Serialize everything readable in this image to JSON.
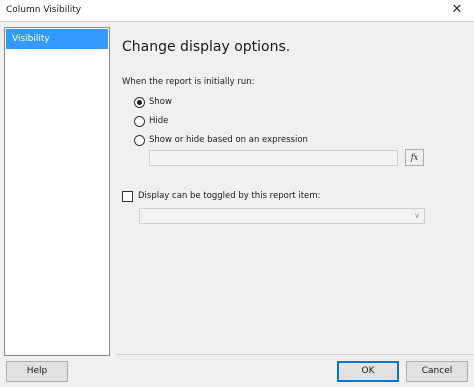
{
  "window": {
    "title": "Column Visibility",
    "close_glyph": "✕"
  },
  "sidebar": {
    "items": [
      {
        "label": "Visibility",
        "selected": true
      }
    ]
  },
  "main": {
    "heading": "Change display options.",
    "intro_label": "When the report is initially run:",
    "radio_options": [
      {
        "label": "Show",
        "checked": true
      },
      {
        "label": "Hide",
        "checked": false
      },
      {
        "label": "Show or hide based on an expression",
        "checked": false
      }
    ],
    "expression_field": {
      "value": "",
      "enabled": false
    },
    "fx_button_label": "fx",
    "toggle_checkbox": {
      "label": "Display can be toggled by this report item:",
      "checked": false
    },
    "toggle_select": {
      "value": "",
      "enabled": false
    }
  },
  "footer": {
    "help_label": "Help",
    "ok_label": "OK",
    "cancel_label": "Cancel"
  },
  "colors": {
    "selection": "#3399ff",
    "primary_border": "#0078d7"
  }
}
